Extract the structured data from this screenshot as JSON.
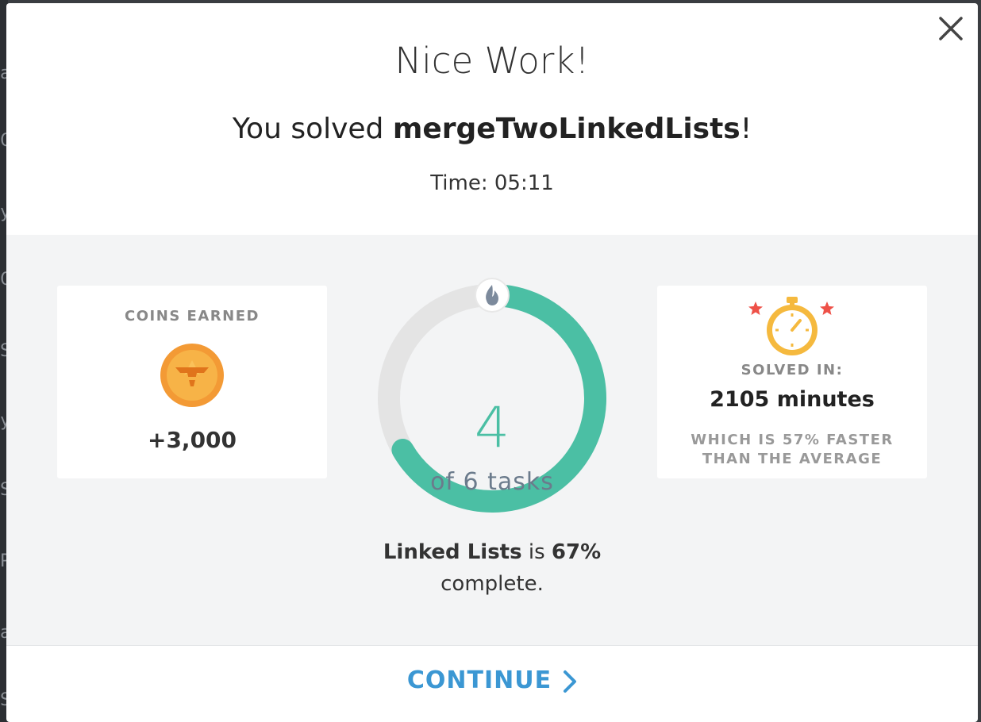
{
  "dialog": {
    "title": "Nice Work!",
    "subtitle_prefix": "You solved ",
    "task_name": "mergeTwoLinkedLists",
    "subtitle_suffix": "!",
    "time": "Time: 05:11"
  },
  "coins": {
    "label": "COINS EARNED",
    "value": "+3,000",
    "icon": "coin-icon"
  },
  "progress": {
    "completed": "4",
    "total_label": "of 6 tasks",
    "completed_fraction": 0.6667,
    "ring_color": "#4bbfa4",
    "topic": "Linked Lists",
    "is_label": " is ",
    "percent": "67%",
    "complete_label": "complete.",
    "badge_icon": "flame-icon"
  },
  "solved": {
    "label": "SOLVED IN:",
    "value": "2105 minutes",
    "comparison_line1": "WHICH IS 57% FASTER",
    "comparison_line2": "THAN THE AVERAGE",
    "icon": "stopwatch-icon"
  },
  "footer": {
    "continue_label": "CONTINUE",
    "accent": "#3b97d3"
  },
  "background": {
    "chars": [
      "a",
      "C",
      "y",
      "C",
      "S",
      "y",
      "S",
      "P",
      "a",
      "S"
    ]
  }
}
